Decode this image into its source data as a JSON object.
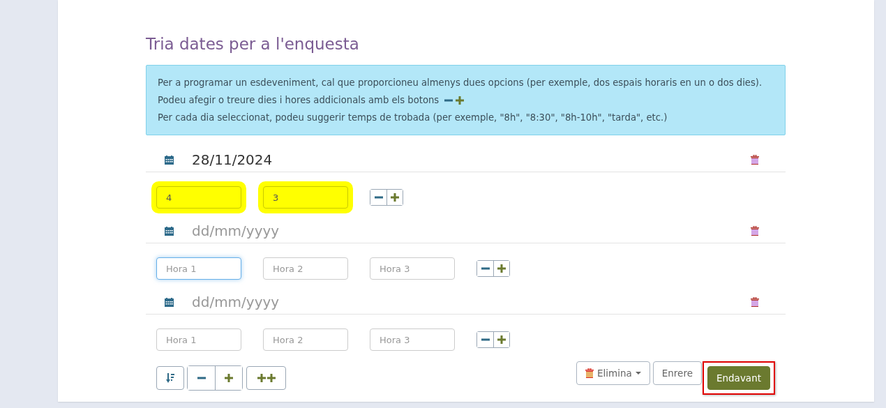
{
  "title": "Tria dates per a l'enquesta",
  "info": {
    "lines": [
      "Per a programar un esdeveniment, cal que proporcioneu almenys dues opcions (per exemple, dos espais horaris en un o dos dies).",
      "Podeu afegir o treure dies i hores addicionals amb els botons",
      "Per cada dia seleccionat, podeu suggerir temps de trobada (per exemple, \"8h\", \"8:30\", \"8h-10h\", \"tarda\", etc.)"
    ]
  },
  "days": [
    {
      "date": {
        "value": "28/11/2024"
      },
      "times": [
        {
          "value": "4",
          "highlighted": true,
          "focused": false
        },
        {
          "value": "3",
          "highlighted": true,
          "focused": false
        }
      ]
    },
    {
      "date": {
        "placeholder": "dd/mm/yyyy"
      },
      "times": [
        {
          "placeholder": "Hora 1",
          "highlighted": false,
          "focused": true
        },
        {
          "placeholder": "Hora 2",
          "highlighted": false,
          "focused": false
        },
        {
          "placeholder": "Hora 3",
          "highlighted": false,
          "focused": false
        }
      ]
    },
    {
      "date": {
        "placeholder": "dd/mm/yyyy"
      },
      "times": [
        {
          "placeholder": "Hora 1",
          "highlighted": false,
          "focused": false
        },
        {
          "placeholder": "Hora 2",
          "highlighted": false,
          "focused": false
        },
        {
          "placeholder": "Hora 3",
          "highlighted": false,
          "focused": false
        }
      ]
    }
  ],
  "actions": [
    {
      "kind": "dropdown",
      "label": "Elimina",
      "highlighted": false
    },
    {
      "kind": "plain",
      "label": "Enrere",
      "highlighted": false
    },
    {
      "kind": "primary",
      "label": "Endavant",
      "highlighted": true
    }
  ]
}
